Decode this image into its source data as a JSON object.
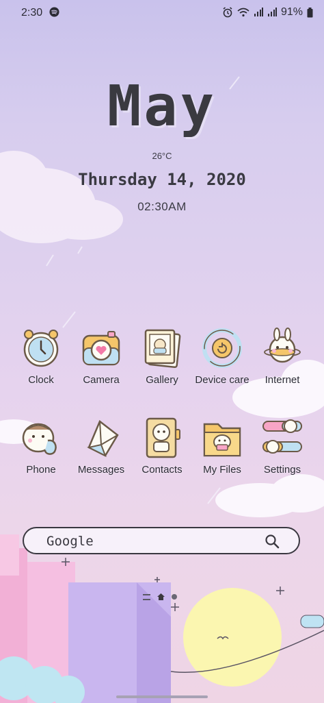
{
  "status_bar": {
    "time": "2:30",
    "battery": "91%"
  },
  "widget": {
    "month": "May",
    "temperature": "26°C",
    "date": "Thursday 14, 2020",
    "time": "02:30AM"
  },
  "apps_row1": [
    {
      "label": "Clock",
      "icon": "clock-icon"
    },
    {
      "label": "Camera",
      "icon": "camera-icon"
    },
    {
      "label": "Gallery",
      "icon": "gallery-icon"
    },
    {
      "label": "Device care",
      "icon": "device-care-icon"
    },
    {
      "label": "Internet",
      "icon": "internet-icon"
    }
  ],
  "apps_row2": [
    {
      "label": "Phone",
      "icon": "phone-icon"
    },
    {
      "label": "Messages",
      "icon": "messages-icon"
    },
    {
      "label": "Contacts",
      "icon": "contacts-icon"
    },
    {
      "label": "My Files",
      "icon": "my-files-icon"
    },
    {
      "label": "Settings",
      "icon": "settings-icon"
    }
  ],
  "search": {
    "label": "Google"
  },
  "colors": {
    "background_top": "#c9c2ec",
    "background_bottom": "#efd5e5",
    "text_dark": "#3a3a42"
  }
}
